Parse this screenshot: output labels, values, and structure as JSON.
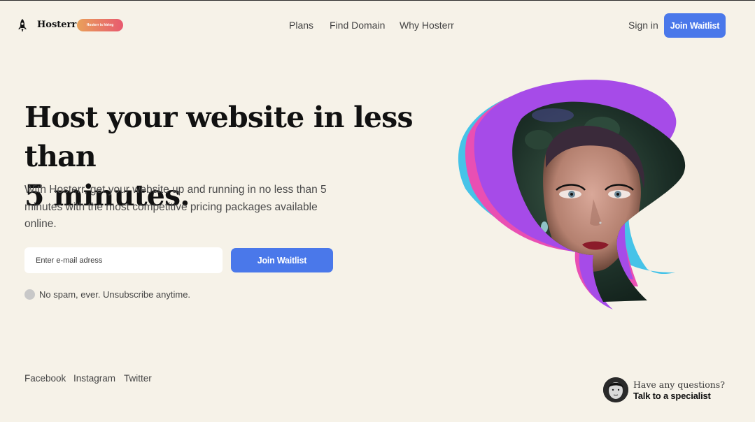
{
  "brand": {
    "name": "Hosterr",
    "hiring_badge": "Hosterr is hiring"
  },
  "nav": {
    "items": [
      "Plans",
      "Find Domain",
      "Why Hosterr"
    ],
    "sign_in": "Sign in",
    "cta": "Join Waitlist"
  },
  "hero": {
    "headline_line1": "Host your website in less than",
    "headline_line2": "5 minutes.",
    "subtext": "With Hosterr, get your website up and running in no less than 5 minutes with the most competitive pricing packages available online.",
    "email_placeholder": "Enter e-mail adress",
    "cta": "Join Waitlist",
    "note": "No spam, ever. Unsubscribe anytime."
  },
  "footer": {
    "social": [
      "Facebook",
      "Instagram",
      "Twitter"
    ],
    "question": "Have any questions?",
    "talk": "Talk to a specialist"
  },
  "colors": {
    "background": "#f6f2e8",
    "accent": "#4a78ea",
    "purple": "#a64be8",
    "pink": "#e94fb3",
    "cyan": "#46c3e8"
  },
  "icons": {
    "logo": "rocket-icon",
    "hero": "hero-portrait-image",
    "avatar": "specialist-avatar"
  }
}
